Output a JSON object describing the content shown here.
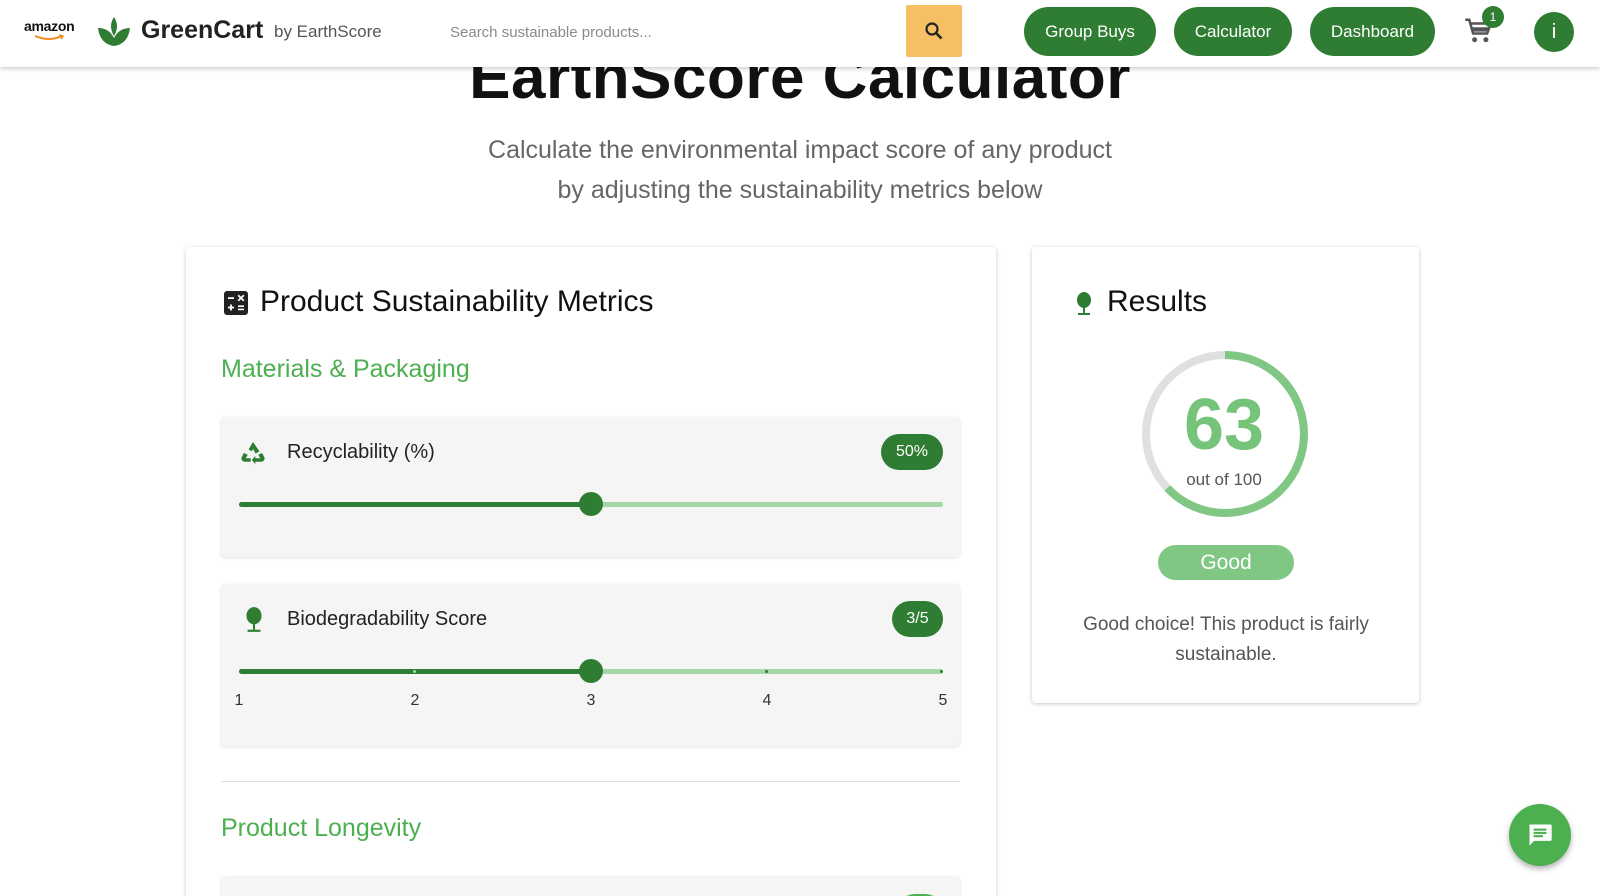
{
  "header": {
    "amazon_logo": "amazon",
    "brand": "GreenCart",
    "by": "by EarthScore",
    "search_placeholder": "Search sustainable products...",
    "nav": [
      "Group Buys",
      "Calculator",
      "Dashboard"
    ],
    "cart_count": "1",
    "avatar_initial": "i",
    "accent": "#2e7d32",
    "search_button_color": "#f7bf63"
  },
  "hero": {
    "title": "EarthScore Calculator",
    "subtitle_line1": "Calculate the environmental impact score of any product",
    "subtitle_line2": "by adjusting the sustainability metrics below"
  },
  "metrics_card": {
    "title": "Product Sustainability Metrics",
    "icon": "calculator-icon",
    "sections": [
      {
        "title": "Materials & Packaging",
        "metrics": [
          {
            "label": "Recyclability (%)",
            "icon": "recycle-icon",
            "value_text": "50%",
            "value": 50,
            "min": 0,
            "max": 100
          },
          {
            "label": "Biodegradability Score",
            "icon": "tree-icon",
            "value_text": "3/5",
            "value": 3,
            "min": 1,
            "max": 5,
            "ticks": [
              "1",
              "2",
              "3",
              "4",
              "5"
            ]
          }
        ]
      },
      {
        "title": "Product Longevity"
      }
    ]
  },
  "results_card": {
    "title": "Results",
    "icon": "tree-icon",
    "score": "63",
    "score_value": 63,
    "score_max": 100,
    "score_caption": "out of 100",
    "rating": "Good",
    "message": "Good choice! This product is fairly sustainable.",
    "score_color": "#76c37a"
  },
  "chat": {
    "icon": "chat-icon"
  }
}
